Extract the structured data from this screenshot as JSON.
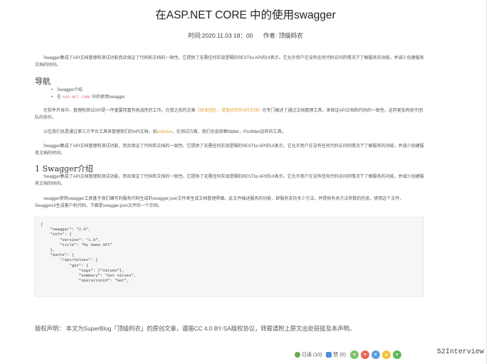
{
  "article": {
    "title": "在ASP.NET CORE 中的使用swagger",
    "time": "时间:2020.11.03 18：00",
    "author": "作者: 顶级码农",
    "intro": "Swagger集成了API文档管理和测试功能而且保证了代码和文档的一致性。它提供了无需任何实现逻辑的RESTful API的UI表示。它允许用户在没有任何代码访问的情况下了解服务的功能，并减少创建服务文档的时间。",
    "nav_heading": "导航",
    "nav_items": [
      "Swagger介绍",
      "在",
      "ASP.NET CORE",
      "中的使用swagger"
    ],
    "para2_a": "在软件开发中，管理和测试API是一件重要而富有挑战性的工作。在我之前的文章",
    "para2_link": "《研发团队，请管好你的API文档》",
    "para2_b": "也专门阐述了通过文档管理工具，来保证API文档和代码的一致性，这样更加有助于团队的协作。",
    "para3_a": "以往我们总是通过第三方平台工具来管理我们的API文档，如",
    "para3_link": "eolinker",
    "para3_b": "。在测试方面，我们也会依赖fiddler，PostMan这样的工具。",
    "para4": "Swagger集成了API文档管理和测试功能，而且保证了代码和文档的一致性。它提供了无需任何实现逻辑的RESTful API的UI表示。它允许用户在没有任何代码访问的情况下了解服务的功能，并减少创建服务文档的时间。",
    "section_heading": "1  Swagger介绍",
    "para5": "Swagger集成了API文档管理和测试功能，而且保证了代码和文档的一致性。它提供了无需任何实现逻辑的RESTful API的UI表示。它允许用户在没有任何代码访问的情况下了解服务的功能，并减少创建服务文档的时间。",
    "para6": "swagger使用swagger工具基于我们编写的服务代码生成的swagger.json文件来生成文档管理界面。此文件描述服务的功能，即服务支持多少方法，并提供有关方法参数的信息。使用这个文件，SwaggerUI生成客户机代码。下面是swagger.json文件的一个示例。",
    "code": "{\n    \"swagger\": \"2.0\",\n    \"info\": {\n        \"version\": \"1.0\",\n        \"title\": \"My Demo API\"\n    },\n    \"paths\": {\n        \"/api/Values\": {\n            \"get\": {\n                \"tags\": [\"Values\"],\n                \"summary\": \"Get values\",\n                \"operationId\": \"Get\",",
    "copyright": "版权声明：  本文为SuperBlog「顶级码农」的原创文章，遵循CC 4.0 BY-SA版权协议，转载请附上原文出处链接及本声明。"
  },
  "footer": {
    "read_label": "已读 (10)",
    "like_label": "赞 (0)",
    "watermark": "52Interview"
  },
  "colors": {
    "accent_orange": "#e8a23a",
    "code_red": "#e06c75",
    "wechat_green": "#7cc36a",
    "weibo_red": "#e86a5a",
    "qq_blue": "#5aa0e0",
    "qzone_yellow": "#f2c23a",
    "douban_green": "#5cb85c"
  },
  "share_icons": [
    "wechat-icon",
    "weibo-icon",
    "qq-icon",
    "qzone-icon",
    "douban-icon"
  ]
}
